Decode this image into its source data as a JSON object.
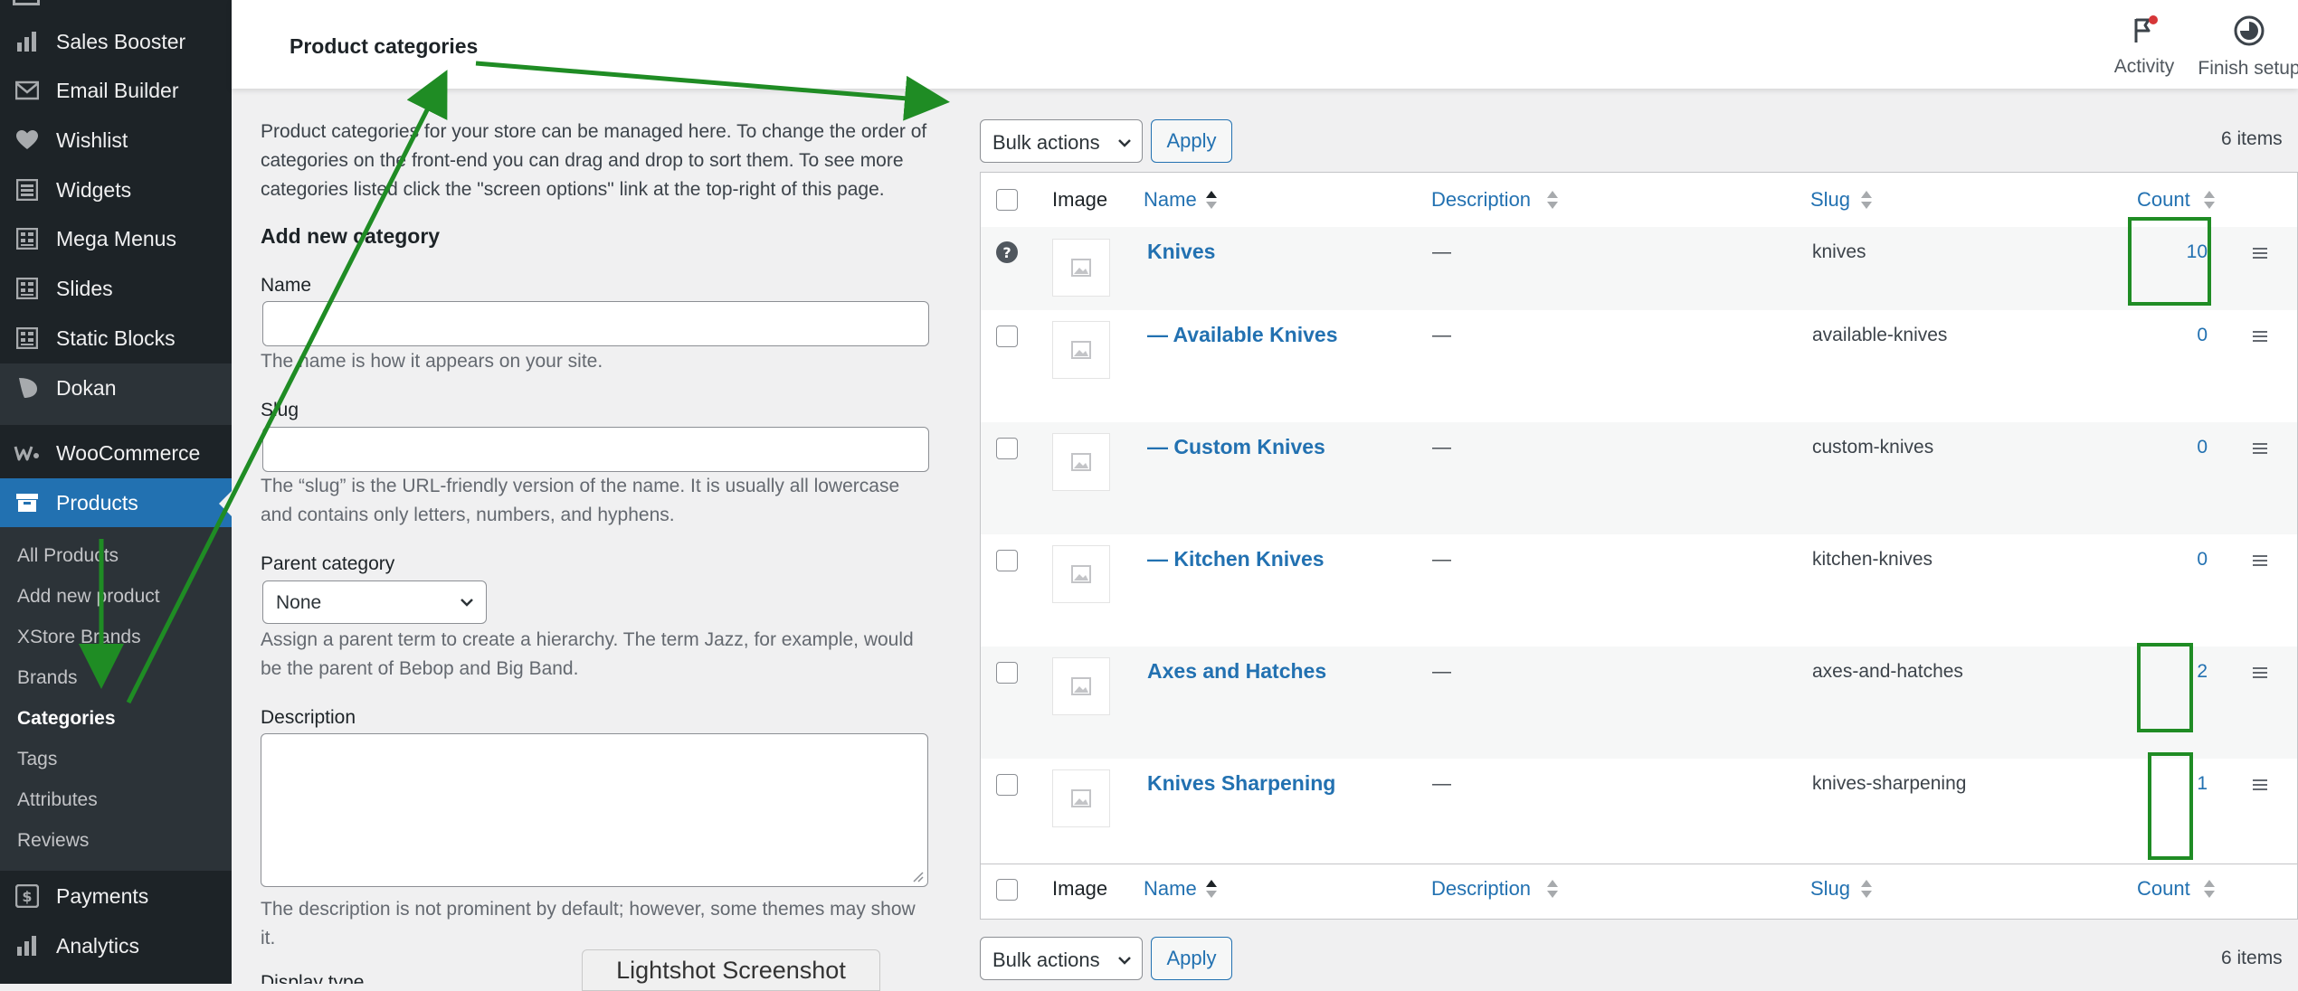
{
  "sidebar": {
    "items": [
      {
        "label": "Sales Booster",
        "icon": "bar-chart-icon"
      },
      {
        "label": "Email Builder",
        "icon": "envelope-icon"
      },
      {
        "label": "Wishlist",
        "icon": "heart-icon"
      },
      {
        "label": "Widgets",
        "icon": "widgets-icon"
      },
      {
        "label": "Mega Menus",
        "icon": "grid-icon"
      },
      {
        "label": "Slides",
        "icon": "grid-icon"
      },
      {
        "label": "Static Blocks",
        "icon": "grid-icon"
      },
      {
        "label": "Dokan",
        "icon": "dokan-icon"
      },
      {
        "label": "WooCommerce",
        "icon": "woocommerce-icon"
      },
      {
        "label": "Products",
        "icon": "archive-icon"
      },
      {
        "label": "Payments",
        "icon": "dollar-icon"
      },
      {
        "label": "Analytics",
        "icon": "bar-chart-icon"
      }
    ],
    "submenu": [
      "All Products",
      "Add new product",
      "XStore Brands",
      "Brands",
      "Categories",
      "Tags",
      "Attributes",
      "Reviews"
    ],
    "current_submenu": "Categories"
  },
  "header": {
    "title": "Product categories",
    "activity_label": "Activity",
    "finish_setup_label": "Finish setup"
  },
  "form": {
    "intro": "Product categories for your store can be managed here. To change the order of categories on the front-end you can drag and drop to sort them. To see more categories listed click the \"screen options\" link at the top-right of this page.",
    "heading": "Add new category",
    "name_label": "Name",
    "name_help": "The name is how it appears on your site.",
    "slug_label": "Slug",
    "slug_help": "The “slug” is the URL-friendly version of the name. It is usually all lowercase and contains only letters, numbers, and hyphens.",
    "parent_label": "Parent category",
    "parent_value": "None",
    "parent_help": "Assign a parent term to create a hierarchy. The term Jazz, for example, would be the parent of Bebop and Big Band.",
    "description_label": "Description",
    "description_help": "The description is not prominent by default; however, some themes may show it.",
    "display_type_label": "Display type"
  },
  "table": {
    "bulk_actions": "Bulk actions",
    "apply": "Apply",
    "items_count": "6 items",
    "columns": {
      "image": "Image",
      "name": "Name",
      "description": "Description",
      "slug": "Slug",
      "count": "Count"
    },
    "rows": [
      {
        "name": "Knives",
        "description": "—",
        "slug": "knives",
        "count": "10",
        "default": true
      },
      {
        "name": "— Available Knives",
        "description": "—",
        "slug": "available-knives",
        "count": "0"
      },
      {
        "name": "— Custom Knives",
        "description": "—",
        "slug": "custom-knives",
        "count": "0"
      },
      {
        "name": "— Kitchen Knives",
        "description": "—",
        "slug": "kitchen-knives",
        "count": "0"
      },
      {
        "name": "Axes and Hatches",
        "description": "—",
        "slug": "axes-and-hatches",
        "count": "2"
      },
      {
        "name": "Knives Sharpening",
        "description": "—",
        "slug": "knives-sharpening",
        "count": "1"
      }
    ]
  },
  "overlay": {
    "lightshot_label": "Lightshot Screenshot",
    "annotation_color": "#1f8c24"
  },
  "colors": {
    "sidebar_bg": "#1d2327",
    "active_blue": "#2271b1",
    "link_blue": "#2271b1"
  }
}
